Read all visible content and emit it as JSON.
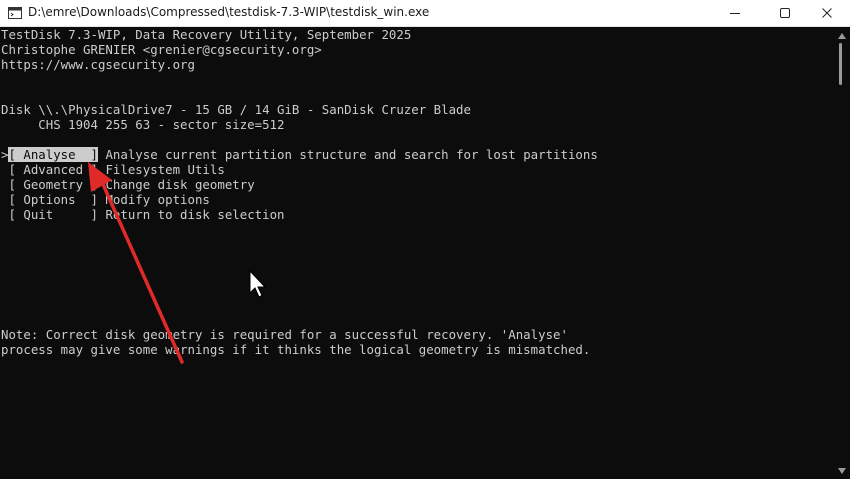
{
  "window": {
    "title": "D:\\emre\\Downloads\\Compressed\\testdisk-7.3-WIP\\testdisk_win.exe"
  },
  "header": {
    "line1": "TestDisk 7.3-WIP, Data Recovery Utility, September 2025",
    "line2": "Christophe GRENIER <grenier@cgsecurity.org>",
    "line3": "https://www.cgsecurity.org"
  },
  "disk": {
    "line1": "Disk \\\\.\\PhysicalDrive7 - 15 GB / 14 GiB - SanDisk Cruzer Blade",
    "line2": "     CHS 1904 255 63 - sector size=512"
  },
  "menu": [
    {
      "prefix": ">",
      "label": "[ Analyse  ]",
      "desc": " Analyse current partition structure and search for lost partitions",
      "selected": true
    },
    {
      "prefix": " ",
      "label": "[ Advanced ]",
      "desc": " Filesystem Utils",
      "selected": false
    },
    {
      "prefix": " ",
      "label": "[ Geometry ]",
      "desc": " Change disk geometry",
      "selected": false
    },
    {
      "prefix": " ",
      "label": "[ Options  ]",
      "desc": " Modify options",
      "selected": false
    },
    {
      "prefix": " ",
      "label": "[ Quit     ]",
      "desc": " Return to disk selection",
      "selected": false
    }
  ],
  "note": {
    "line1": "Note: Correct disk geometry is required for a successful recovery. 'Analyse'",
    "line2": "process may give some warnings if it thinks the logical geometry is mismatched."
  },
  "icons": {
    "app": "console-app-icon",
    "minimize": "minimize-icon",
    "maximize": "maximize-icon",
    "close": "close-icon",
    "pointer": "mouse-pointer-icon",
    "annotation": "red-arrow-annotation"
  },
  "colors": {
    "background": "#0c0c0c",
    "text": "#cccccc",
    "selection": "#cccccc",
    "annotation": "#e02a2a"
  }
}
